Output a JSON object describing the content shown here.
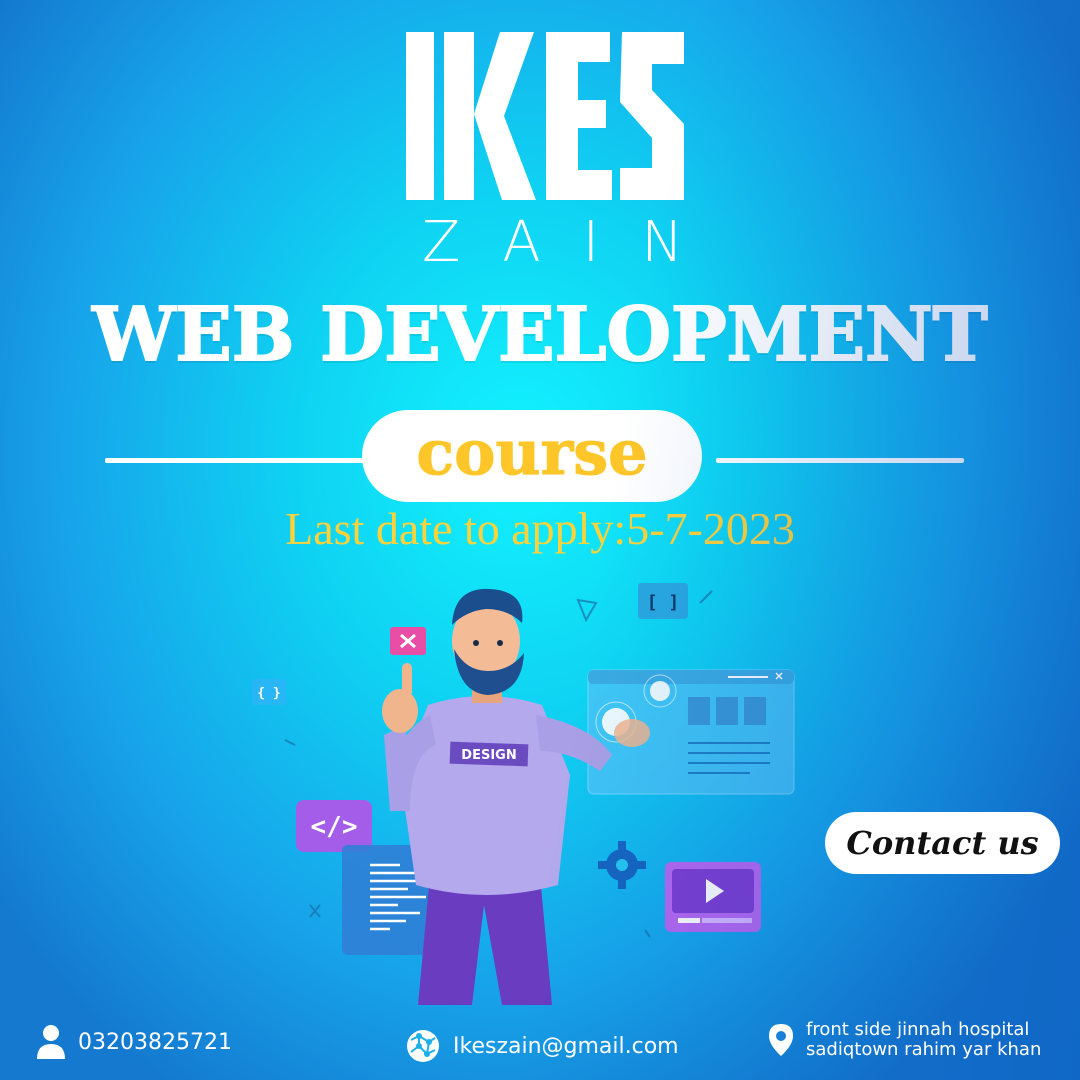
{
  "logo": {
    "mark": "IKES",
    "subtitle": "ZAIN"
  },
  "headline": "WEB DEVELOPMENT",
  "course_label": "course",
  "deadline": "Last date to apply:5-7-2023",
  "illustration": {
    "shirt_label": "DESIGN",
    "code_tag": "</>",
    "brackets": "[ ]",
    "braces": "{ }"
  },
  "contact_button": "Contact us",
  "footer": {
    "phone": "03203825721",
    "email": "Ikeszain@gmail.com",
    "address_line1": "front side jinnah hospital",
    "address_line2": "sadiqtown rahim yar khan"
  },
  "colors": {
    "accent_yellow": "#ffc629",
    "bg_cyan": "#12f3ff",
    "bg_blue": "#1479cf"
  },
  "icons": [
    "user-icon",
    "globe-icon",
    "location-pin-icon",
    "play-icon",
    "gear-icon"
  ]
}
